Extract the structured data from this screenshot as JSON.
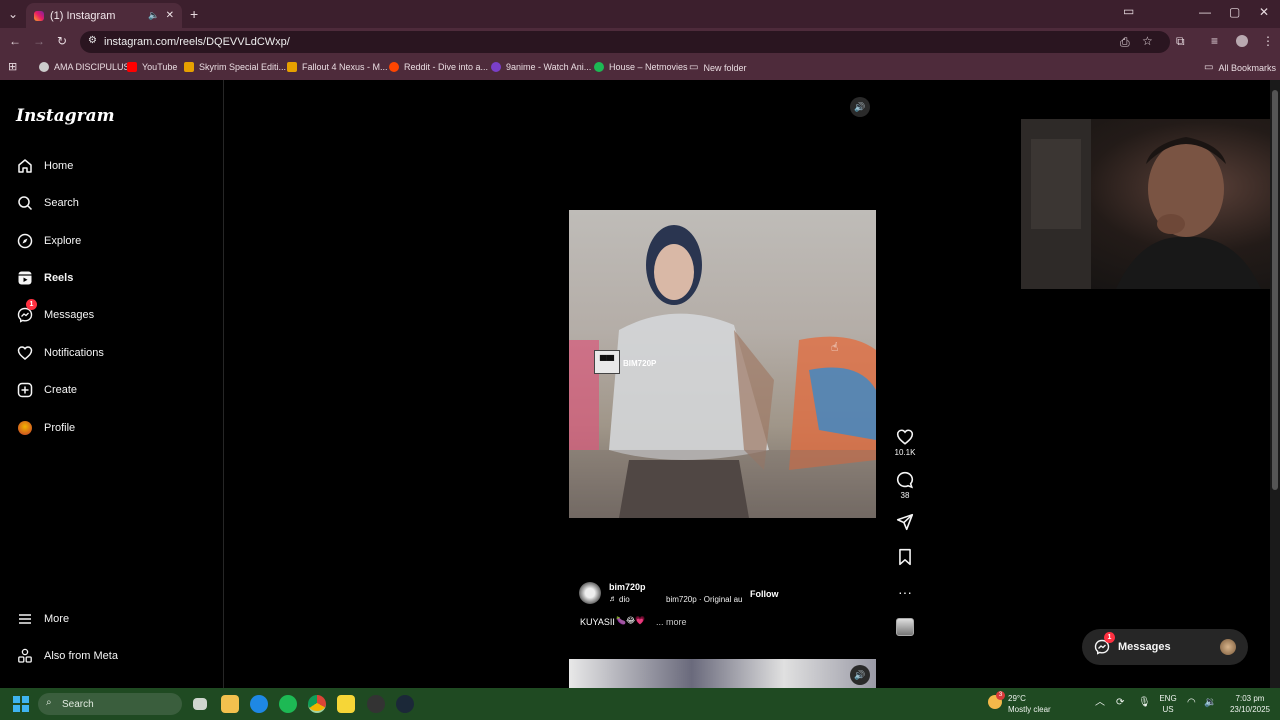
{
  "browser": {
    "tab_title": "(1) Instagram",
    "url": "instagram.com/reels/DQEVVLdCWxp/",
    "bookmarks": [
      "AMA DISCIPULUS",
      "YouTube",
      "Skyrim Special Editi...",
      "Fallout 4 Nexus - M...",
      "Reddit - Dive into a...",
      "9anime - Watch Ani...",
      "House – Netmovies",
      "New folder"
    ],
    "all_bookmarks": "All Bookmarks"
  },
  "sidebar": {
    "logo": "Instagram",
    "items": [
      {
        "label": "Home",
        "icon": "home-icon"
      },
      {
        "label": "Search",
        "icon": "search-icon"
      },
      {
        "label": "Explore",
        "icon": "compass-icon"
      },
      {
        "label": "Reels",
        "icon": "reels-icon"
      },
      {
        "label": "Messages",
        "icon": "messenger-icon",
        "badge": "1"
      },
      {
        "label": "Notifications",
        "icon": "heart-icon"
      },
      {
        "label": "Create",
        "icon": "plus-icon"
      },
      {
        "label": "Profile",
        "icon": "avatar"
      }
    ],
    "more": "More",
    "meta": "Also from Meta"
  },
  "reel": {
    "watermark": "BIM720P",
    "likes": "10.1K",
    "comments": "38",
    "username": "bim720p",
    "audio": "dio",
    "audio_track": "bim720p · Original au",
    "follow_label": "Follow",
    "caption": "KUYASII",
    "caption_more": "... more"
  },
  "messages_pill": {
    "label": "Messages",
    "badge": "1"
  },
  "taskbar": {
    "search": "Search",
    "weather_temp": "29°C",
    "weather_desc": "Mostly clear",
    "weather_badge": "3",
    "lang": "ENG",
    "region": "US",
    "time": "7:03 pm",
    "date": "23/10/2025"
  },
  "colors": {
    "chrome_bg": "#4e2b3b",
    "taskbar_bg": "#1f4a22",
    "badge_red": "#ff3040"
  }
}
